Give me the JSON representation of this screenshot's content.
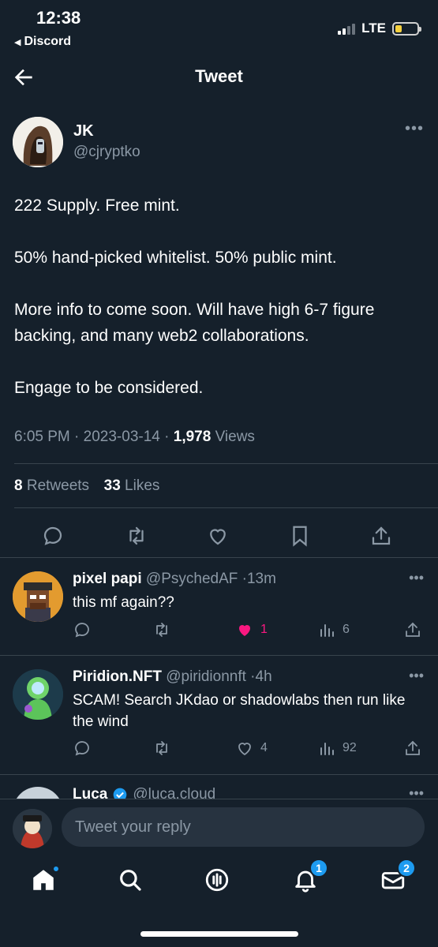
{
  "status_bar": {
    "time": "12:38",
    "back_app": "Discord",
    "network": "LTE",
    "signal_bars": 2,
    "battery_level": 0.2
  },
  "header": {
    "title": "Tweet",
    "back_icon": "arrow-left-icon"
  },
  "tweet": {
    "author_name": "JK",
    "author_handle": "@cjryptko",
    "more_icon": "more-horizontal-icon",
    "paragraphs": [
      "222 Supply. Free mint.",
      "50% hand-picked whitelist. 50% public mint.",
      "More info to come soon. Will have high 6-7 figure backing, and many web2 collaborations.",
      "Engage to be considered."
    ],
    "time": "6:05 PM",
    "date": "2023-03-14",
    "views_count": "1,978",
    "views_label": "Views",
    "retweets_count": "8",
    "retweets_label": "Retweets",
    "likes_count": "33",
    "likes_label": "Likes",
    "actions": [
      "reply-icon",
      "retweet-icon",
      "like-icon",
      "bookmark-icon",
      "share-icon"
    ]
  },
  "replies": [
    {
      "name": "pixel papi",
      "handle": "@PsychedAF",
      "age": "13m",
      "text": "this mf again??",
      "likes": "1",
      "liked": true,
      "views": "6"
    },
    {
      "name": "Piridion.NFT",
      "handle": "@piridionnft",
      "age": "4h",
      "text": "SCAM! Search JKdao or shadowlabs then run like the wind",
      "likes": "4",
      "liked": false,
      "views": "92"
    },
    {
      "name": "Luca",
      "handle": "@luca.cloud",
      "verified": true
    }
  ],
  "reply_bar": {
    "placeholder": "Tweet your reply"
  },
  "bottom_nav": {
    "items": [
      "home-icon",
      "search-icon",
      "spaces-icon",
      "notifications-icon",
      "messages-icon"
    ],
    "notifications_badge": "1",
    "messages_badge": "2"
  },
  "colors": {
    "background": "#15202b",
    "muted_text": "#8b98a5",
    "accent": "#1d9bf0",
    "like": "#f91880",
    "divider": "#38444d"
  }
}
